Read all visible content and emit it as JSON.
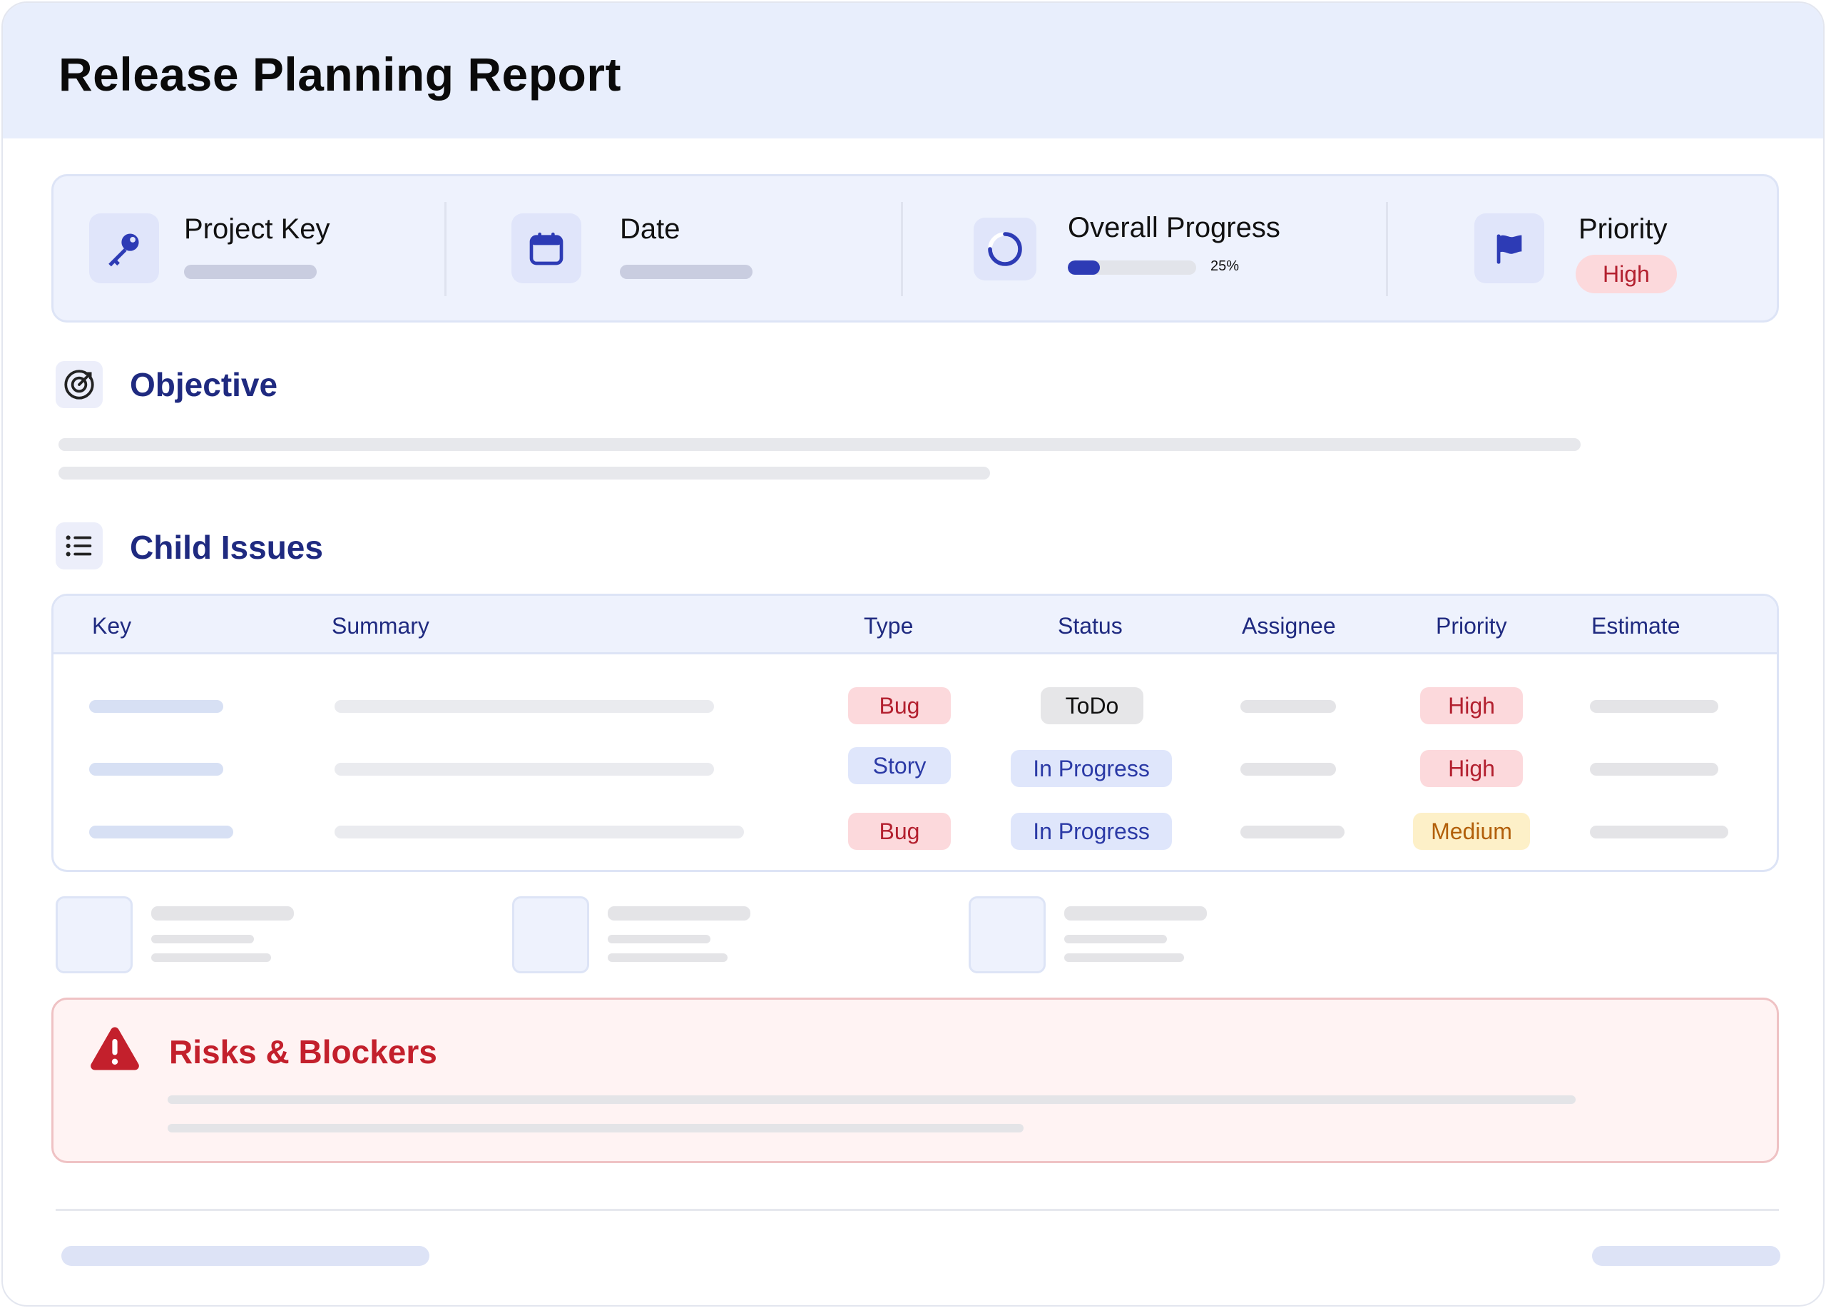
{
  "header": {
    "title": "Release Planning Report"
  },
  "info": {
    "project_key_label": "Project Key",
    "date_label": "Date",
    "progress_label": "Overall Progress",
    "progress_value": 0.25,
    "progress_text": "25%",
    "priority_label": "Priority",
    "priority_value": "High",
    "icons": [
      "key-icon",
      "calendar-icon",
      "progress-spinner-icon",
      "flag-icon"
    ]
  },
  "objective": {
    "title": "Objective",
    "icon": "target-icon"
  },
  "child_issues": {
    "title": "Child Issues",
    "icon": "list-icon",
    "columns": [
      "Key",
      "Summary",
      "Type",
      "Status",
      "Assignee",
      "Priority",
      "Estimate"
    ],
    "rows": [
      {
        "type": "Bug",
        "status": "ToDo",
        "priority": "High"
      },
      {
        "type": "Story",
        "status": "In Progress",
        "priority": "High"
      },
      {
        "type": "Bug",
        "status": "In Progress",
        "priority": "Medium"
      }
    ]
  },
  "risks": {
    "title": "Risks & Blockers",
    "icon": "warning-icon"
  },
  "colors": {
    "accent": "#1f2a80",
    "header_bg": "#e8eefc",
    "danger": "#c3202c",
    "progress_fill": "#2d3bb5"
  }
}
